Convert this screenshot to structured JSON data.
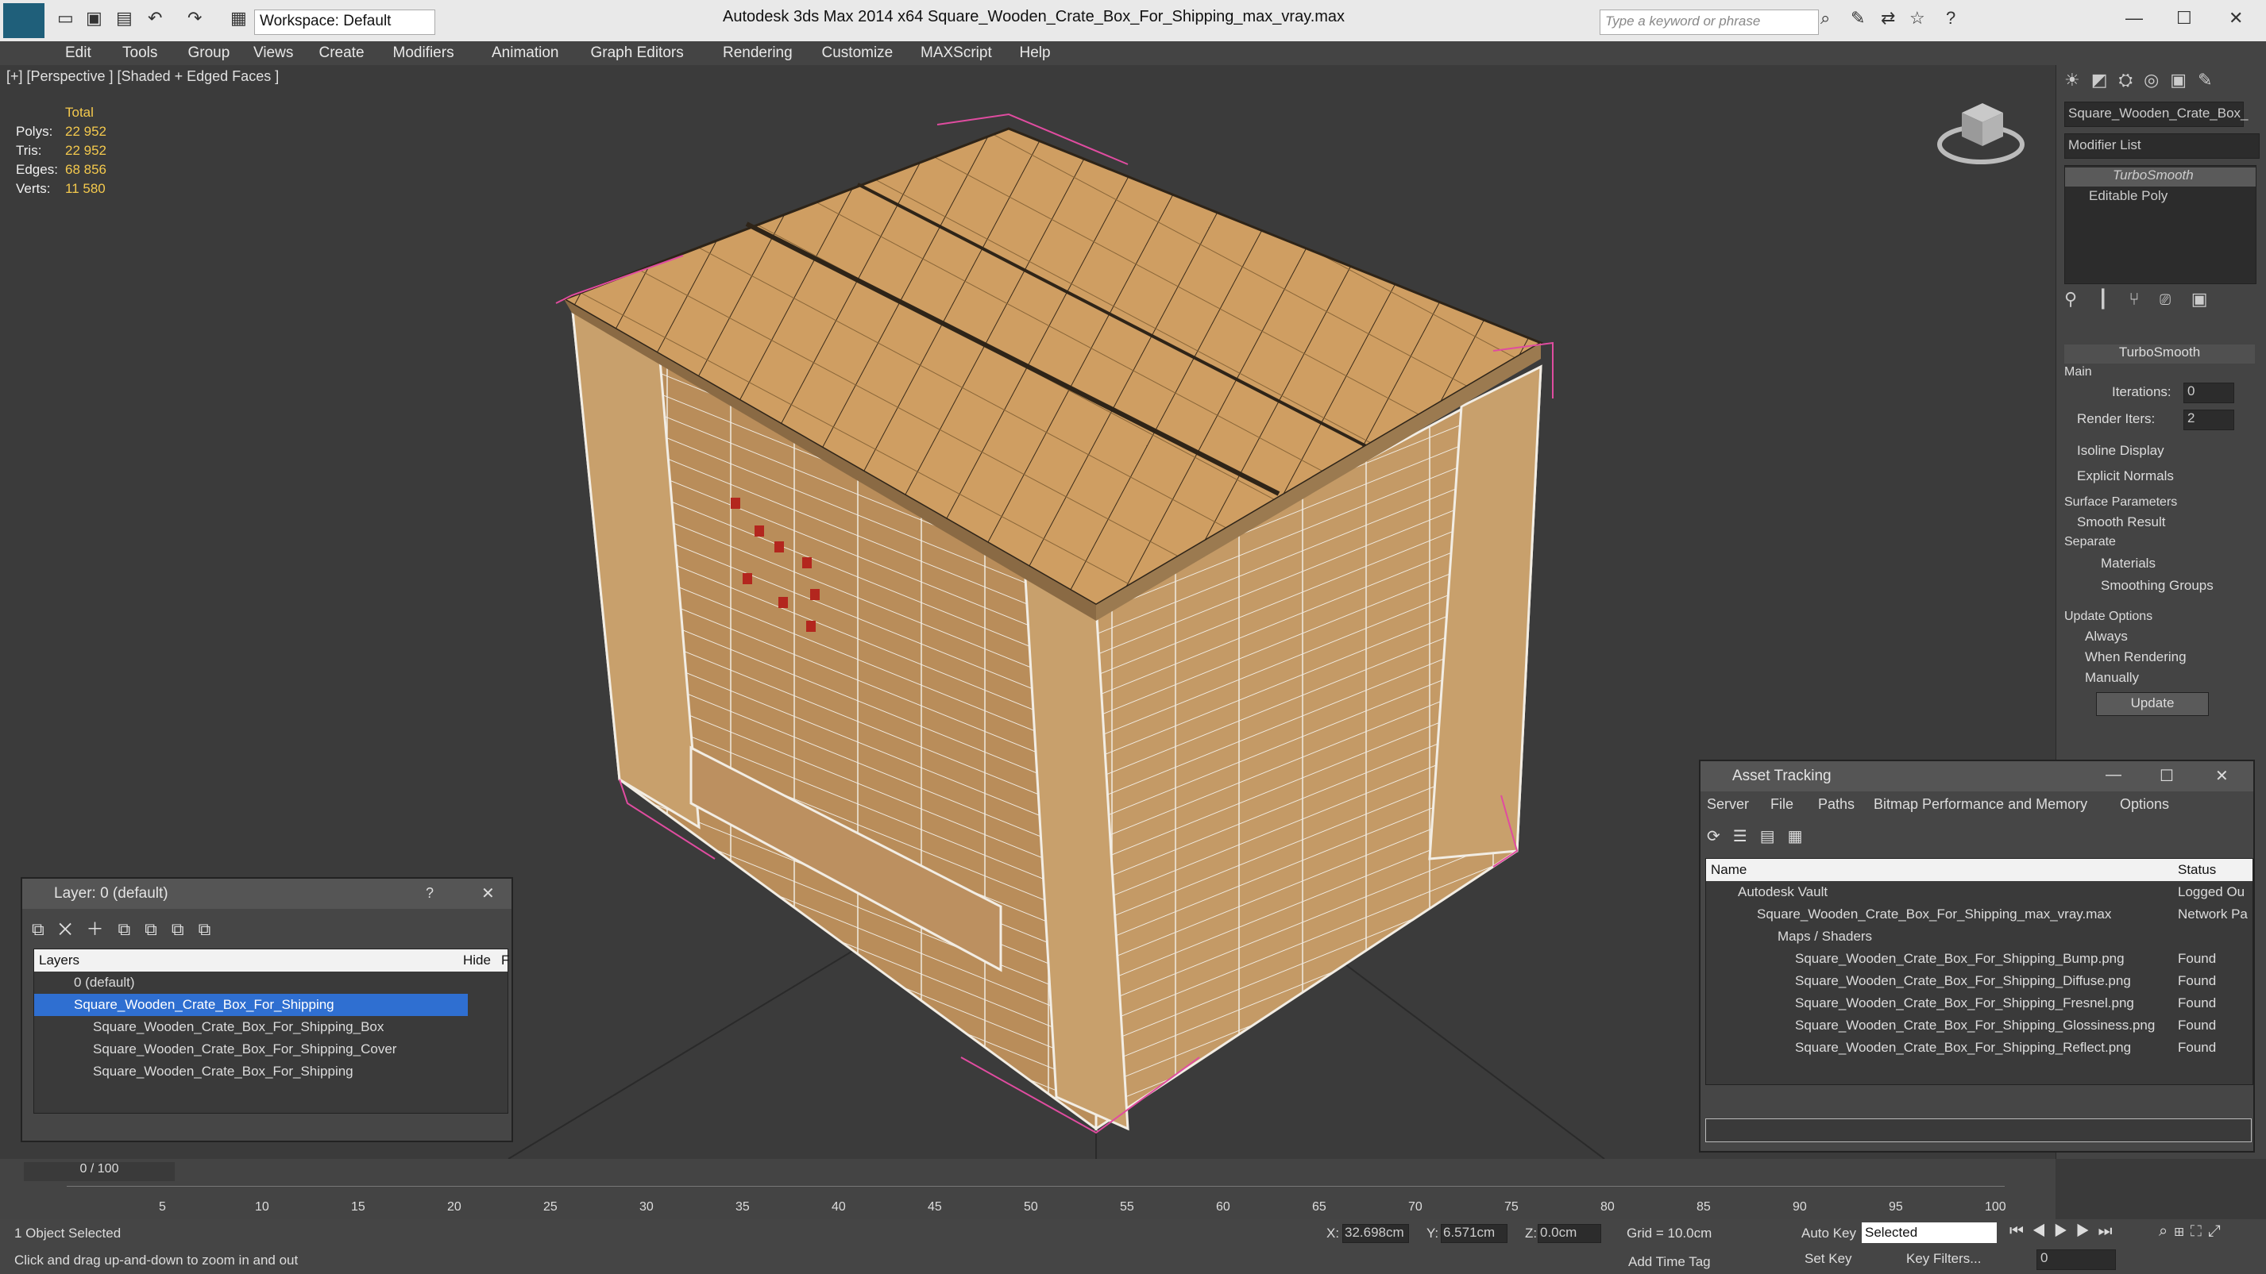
{
  "window": {
    "title": "Autodesk 3ds Max  2014 x64     Square_Wooden_Crate_Box_For_Shipping_max_vray.max",
    "workspace": "Workspace: Default",
    "search_placeholder": "Type a keyword or phrase"
  },
  "menu": [
    "Edit",
    "Tools",
    "Group",
    "Views",
    "Create",
    "Modifiers",
    "Animation",
    "Graph Editors",
    "Rendering",
    "Customize",
    "MAXScript",
    "Help"
  ],
  "viewport": {
    "label": "[+] [Perspective ] [Shaded + Edged Faces ]",
    "stats": {
      "header": "Total",
      "rows": [
        {
          "label": "Polys:",
          "value": "22 952"
        },
        {
          "label": "Tris:",
          "value": "22 952"
        },
        {
          "label": "Edges:",
          "value": "68 856"
        },
        {
          "label": "Verts:",
          "value": "11 580"
        }
      ]
    }
  },
  "command_panel": {
    "object_name": "Square_Wooden_Crate_Box_",
    "modifier_list": "Modifier List",
    "stack": [
      "TurboSmooth",
      "Editable Poly"
    ],
    "rollout_title": "TurboSmooth",
    "main_label": "Main",
    "iterations_label": "Iterations:",
    "iterations_value": "0",
    "render_iters_label": "Render Iters:",
    "render_iters_value": "2",
    "isoline": "Isoline Display",
    "explicit_normals": "Explicit Normals",
    "surface_params": "Surface Parameters",
    "smooth_result": "Smooth Result",
    "separate": "Separate",
    "materials": "Materials",
    "smoothing_groups": "Smoothing Groups",
    "update_options": "Update Options",
    "always": "Always",
    "when_rendering": "When Rendering",
    "manually": "Manually",
    "update_button": "Update"
  },
  "layer_window": {
    "title": "Layer: 0 (default)",
    "help": "?",
    "col_layers": "Layers",
    "col_hide": "Hide",
    "col_f": "F",
    "rows": [
      {
        "label": "0 (default)"
      },
      {
        "label": "Square_Wooden_Crate_Box_For_Shipping"
      },
      {
        "label": "Square_Wooden_Crate_Box_For_Shipping_Box"
      },
      {
        "label": "Square_Wooden_Crate_Box_For_Shipping_Cover"
      },
      {
        "label": "Square_Wooden_Crate_Box_For_Shipping"
      }
    ]
  },
  "asset_window": {
    "title": "Asset Tracking",
    "menu": [
      "Server",
      "File",
      "Paths",
      "Bitmap Performance and Memory",
      "Options"
    ],
    "col_name": "Name",
    "col_status": "Status",
    "rows": [
      {
        "name": "Autodesk Vault",
        "status": "Logged Ou"
      },
      {
        "name": "Square_Wooden_Crate_Box_For_Shipping_max_vray.max",
        "status": "Network Pa"
      },
      {
        "name": "Maps / Shaders",
        "status": ""
      },
      {
        "name": "Square_Wooden_Crate_Box_For_Shipping_Bump.png",
        "status": "Found"
      },
      {
        "name": "Square_Wooden_Crate_Box_For_Shipping_Diffuse.png",
        "status": "Found"
      },
      {
        "name": "Square_Wooden_Crate_Box_For_Shipping_Fresnel.png",
        "status": "Found"
      },
      {
        "name": "Square_Wooden_Crate_Box_For_Shipping_Glossiness.png",
        "status": "Found"
      },
      {
        "name": "Square_Wooden_Crate_Box_For_Shipping_Reflect.png",
        "status": "Found"
      }
    ]
  },
  "timeline": {
    "frame": "0 / 100",
    "ticks": [
      "5",
      "10",
      "15",
      "20",
      "25",
      "30",
      "35",
      "40",
      "45",
      "50",
      "55",
      "60",
      "65",
      "70",
      "75",
      "80",
      "85",
      "90",
      "95",
      "100"
    ]
  },
  "status": {
    "selected": "1 Object Selected",
    "prompt": "Click and drag up-and-down to zoom in and out",
    "x_label": "X:",
    "x_value": "32.698cm",
    "y_label": "Y:",
    "y_value": "6.571cm",
    "z_label": "Z:",
    "z_value": "0.0cm",
    "grid": "Grid = 10.0cm",
    "add_time_tag": "Add Time Tag",
    "auto_key": "Auto Key",
    "set_key": "Set Key",
    "selected_dropdown": "Selected",
    "key_filters": "Key Filters...",
    "frame_value": "0"
  },
  "colors": {
    "accent": "#f4c94d",
    "selection": "#2f6fd1",
    "wood": "#c89a5c"
  }
}
